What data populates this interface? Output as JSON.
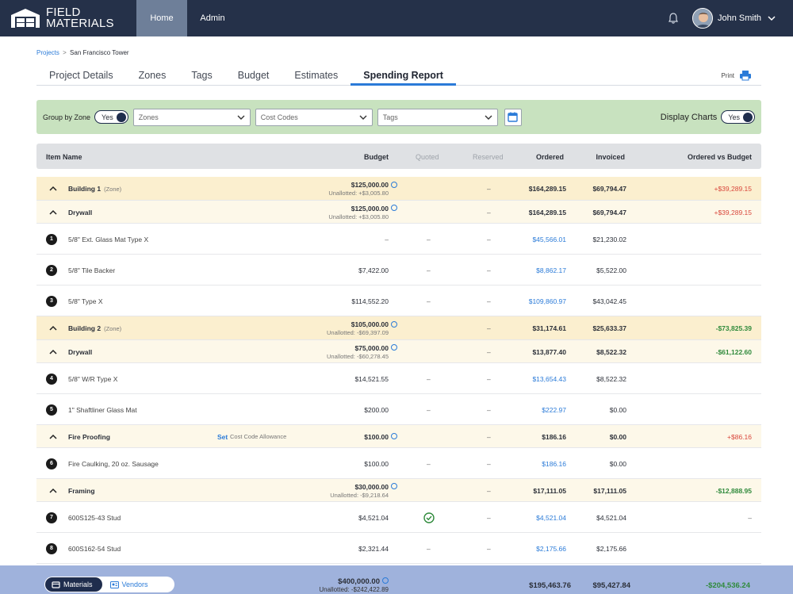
{
  "app": {
    "logo_line1": "FIELD",
    "logo_line2": "MATERIALS"
  },
  "nav": {
    "home": "Home",
    "admin": "Admin",
    "user_name": "John Smith"
  },
  "breadcrumb": {
    "projects": "Projects",
    "separator": ">",
    "current": "San Francisco Tower"
  },
  "tabs": [
    "Project Details",
    "Zones",
    "Tags",
    "Budget",
    "Estimates",
    "Spending Report"
  ],
  "active_tab": "Spending Report",
  "print_label": "Print",
  "filters": {
    "group_by_zone_label": "Group by Zone",
    "group_by_zone_value": "Yes",
    "zones_placeholder": "Zones",
    "cost_codes_placeholder": "Cost Codes",
    "tags_placeholder": "Tags",
    "display_charts_label": "Display Charts",
    "display_charts_value": "Yes"
  },
  "columns": {
    "item_name": "Item Name",
    "budget": "Budget",
    "quoted": "Quoted",
    "reserved": "Reserved",
    "ordered": "Ordered",
    "invoiced": "Invoiced",
    "ordered_vs_budget": "Ordered vs Budget"
  },
  "rows": [
    {
      "type": "zone",
      "name": "Building 1",
      "suffix": "(Zone)",
      "budget": "$125,000.00",
      "sub": "Unallotted: +$3,005.80",
      "reserved": "–",
      "ordered": "$164,289.15",
      "invoiced": "$69,794.47",
      "ovb": "+$39,289.15",
      "ovb_color": "red"
    },
    {
      "type": "group",
      "name": "Drywall",
      "budget": "$125,000.00",
      "sub": "Unallotted: +$3,005.80",
      "reserved": "–",
      "ordered": "$164,289.15",
      "invoiced": "$69,794.47",
      "ovb": "+$39,289.15",
      "ovb_color": "red"
    },
    {
      "type": "item",
      "num": "1",
      "name": "5/8\" Ext. Glass Mat Type X",
      "budget": "–",
      "quoted": "–",
      "reserved": "–",
      "ordered": "$45,566.01",
      "invoiced": "$21,230.02",
      "ovb": ""
    },
    {
      "type": "item",
      "num": "2",
      "name": "5/8\" Tile Backer",
      "budget": "$7,422.00",
      "quoted": "–",
      "reserved": "–",
      "ordered": "$8,862.17",
      "invoiced": "$5,522.00",
      "ovb": ""
    },
    {
      "type": "item",
      "num": "3",
      "name": "5/8\" Type X",
      "budget": "$114,552.20",
      "quoted": "–",
      "reserved": "–",
      "ordered": "$109,860.97",
      "invoiced": "$43,042.45",
      "ovb": ""
    },
    {
      "type": "zone",
      "name": "Building 2",
      "suffix": "(Zone)",
      "budget": "$105,000.00",
      "sub": "Unallotted: -$69,397.09",
      "reserved": "–",
      "ordered": "$31,174.61",
      "invoiced": "$25,633.37",
      "ovb": "-$73,825.39",
      "ovb_color": "green"
    },
    {
      "type": "group",
      "name": "Drywall",
      "budget": "$75,000.00",
      "sub": "Unallotted: -$60,278.45",
      "reserved": "–",
      "ordered": "$13,877.40",
      "invoiced": "$8,522.32",
      "ovb": "-$61,122.60",
      "ovb_color": "green"
    },
    {
      "type": "item",
      "num": "4",
      "name": "5/8\" W/R Type X",
      "budget": "$14,521.55",
      "quoted": "–",
      "reserved": "–",
      "ordered": "$13,654.43",
      "invoiced": "$8,522.32",
      "ovb": ""
    },
    {
      "type": "item",
      "num": "5",
      "name": "1\" Shaftliner Glass Mat",
      "budget": "$200.00",
      "quoted": "–",
      "reserved": "–",
      "ordered": "$222.97",
      "invoiced": "$0.00",
      "ovb": ""
    },
    {
      "type": "group",
      "name": "Fire Proofing",
      "set_link": "Set",
      "set_text": "Cost Code Allowance",
      "budget": "$100.00",
      "sub": "",
      "reserved": "–",
      "ordered": "$186.16",
      "invoiced": "$0.00",
      "ovb": "+$86.16",
      "ovb_color": "red"
    },
    {
      "type": "item",
      "num": "6",
      "name": "Fire Caulking, 20 oz. Sausage",
      "budget": "$100.00",
      "quoted": "–",
      "reserved": "–",
      "ordered": "$186.16",
      "invoiced": "$0.00",
      "ovb": ""
    },
    {
      "type": "group",
      "name": "Framing",
      "budget": "$30,000.00",
      "sub": "Unallotted: -$9,218.64",
      "reserved": "–",
      "ordered": "$17,111.05",
      "invoiced": "$17,111.05",
      "ovb": "-$12,888.95",
      "ovb_color": "green"
    },
    {
      "type": "item",
      "num": "7",
      "name": "600S125-43 Stud",
      "budget": "$4,521.04",
      "quoted_check": true,
      "reserved": "–",
      "ordered": "$4,521.04",
      "invoiced": "$4,521.04",
      "ovb": "–"
    },
    {
      "type": "item",
      "num": "8",
      "name": "600S162-54 Stud",
      "budget": "$2,321.44",
      "quoted": "–",
      "reserved": "–",
      "ordered": "$2,175.66",
      "invoiced": "$2,175.66",
      "ovb": ""
    }
  ],
  "footer": {
    "materials_label": "Materials",
    "vendors_label": "Vendors",
    "budget": "$400,000.00",
    "unallotted": "Unallotted: -$242,422.89",
    "ordered": "$195,463.76",
    "invoiced": "$95,427.84",
    "ovb": "-$204,536.24"
  }
}
